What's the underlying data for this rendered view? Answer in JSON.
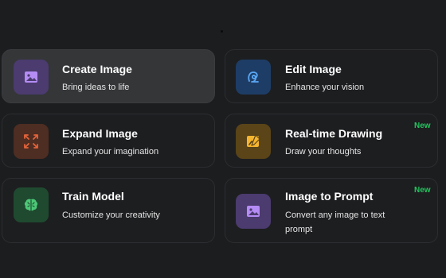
{
  "cards": [
    {
      "title": "Create Image",
      "desc": "Bring ideas to life",
      "icon": "image-icon",
      "icon_bg": "#4b3b6e",
      "icon_color": "#b58cf5",
      "badge": ""
    },
    {
      "title": "Edit Image",
      "desc": "Enhance your vision",
      "icon": "edit-icon",
      "icon_bg": "#1e3d66",
      "icon_color": "#5aa8f5",
      "badge": ""
    },
    {
      "title": "Expand Image",
      "desc": "Expand your imagination",
      "icon": "expand-icon",
      "icon_bg": "#4e2d22",
      "icon_color": "#e2633b",
      "badge": ""
    },
    {
      "title": "Real-time Drawing",
      "desc": "Draw your thoughts",
      "icon": "drawing-icon",
      "icon_bg": "#5a4418",
      "icon_color": "#f5b52f",
      "badge": "New"
    },
    {
      "title": "Train Model",
      "desc": "Customize your creativity",
      "icon": "brain-icon",
      "icon_bg": "#1f4a30",
      "icon_color": "#4cc776",
      "badge": ""
    },
    {
      "title": "Image to Prompt",
      "desc": "Convert any image to text prompt",
      "icon": "image-icon",
      "icon_bg": "#4b3b6e",
      "icon_color": "#b58cf5",
      "badge": "New"
    }
  ]
}
